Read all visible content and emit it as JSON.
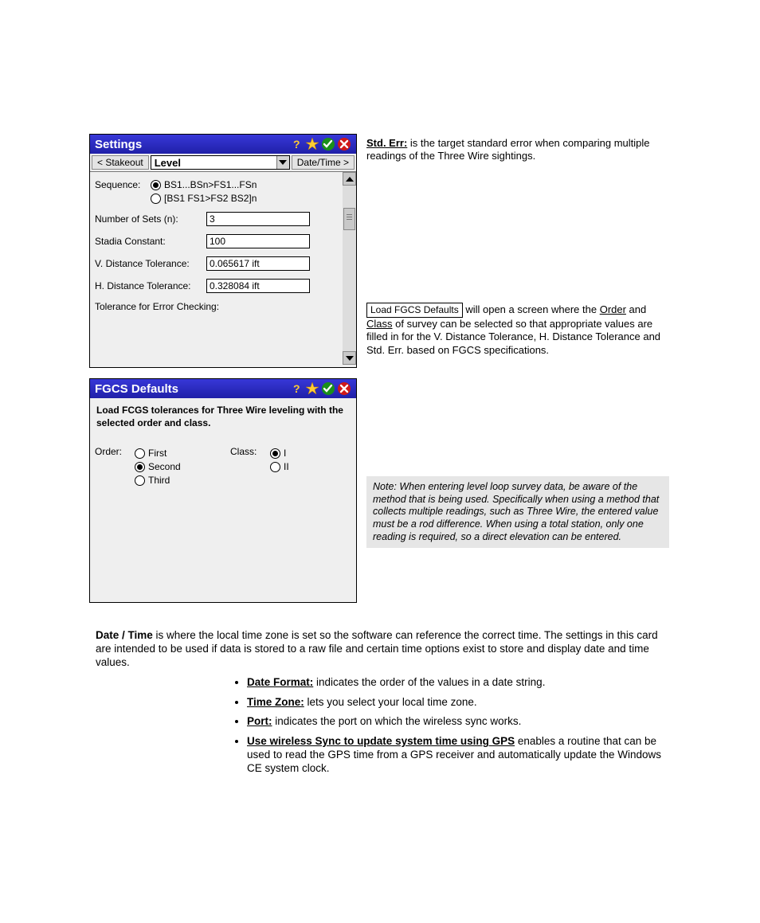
{
  "settings": {
    "title": "Settings",
    "back_btn": "< Stakeout",
    "dropdown": "Level",
    "fwd_btn": "Date/Time >",
    "seq_label": "Sequence:",
    "seq_opt1": "BS1...BSn>FS1...FSn",
    "seq_opt2": "[BS1 FS1>FS2 BS2]n",
    "numsets_label": "Number of Sets (n):",
    "numsets_val": "3",
    "stadia_label": "Stadia Constant:",
    "stadia_val": "100",
    "vdt_label": "V. Distance Tolerance:",
    "vdt_val": "0.065617 ift",
    "hdt_label": "H. Distance Tolerance:",
    "hdt_val": "0.328084 ift",
    "tolerr_label": "Tolerance for Error Checking:"
  },
  "fgcs": {
    "title": "FGCS Defaults",
    "desc": "Load FCGS tolerances for Three Wire leveling with the selected order and class.",
    "order_label": "Order:",
    "class_label": "Class:",
    "order_first": "First",
    "order_second": "Second",
    "order_third": "Third",
    "class_i": "I",
    "class_ii": "II"
  },
  "right": {
    "std_err_hdr1": "Std. Err:",
    "std_err_body1": " is the target standard error when comparing multiple readings of the Three Wire sightings.",
    "load_btn_label": "Load FGCS Defaults",
    "load_body": " will open a screen where the ",
    "load_order": "Order",
    "load_and": " and ",
    "load_class": "Class",
    "load_body2": " of survey can be selected so that appropriate values are filled in for the V. Distance Tolerance, H. Distance Tolerance and Std. Err. based on FGCS specifications.",
    "note": "Note: When entering level loop survey data, be aware of the method that is being used. Specifically when using a method that collects multiple readings, such as Three Wire, the entered value must be a rod difference. When using a total station, only one reading is required, so a direct elevation can be entered."
  },
  "bottom": {
    "intro_hdr": "Date / Time",
    "intro_body": " is where the local time zone is set so the software can reference the correct time. The settings in this card are intended to be used if data is stored to a raw file and certain time options exist to store and display date and time values.",
    "b1": "Date Format:",
    "b1b": " indicates the order of the values in a date string.",
    "b2": "Time Zone:",
    "b2b": " lets you select your local time zone.",
    "b3": "Port:",
    "b3b": " indicates the port on which the wireless sync works.",
    "b4": "Use wireless Sync to update system time using GPS",
    "b4b": " enables a routine that can be used to read the GPS time from a GPS receiver and automatically update the Windows CE system clock."
  }
}
